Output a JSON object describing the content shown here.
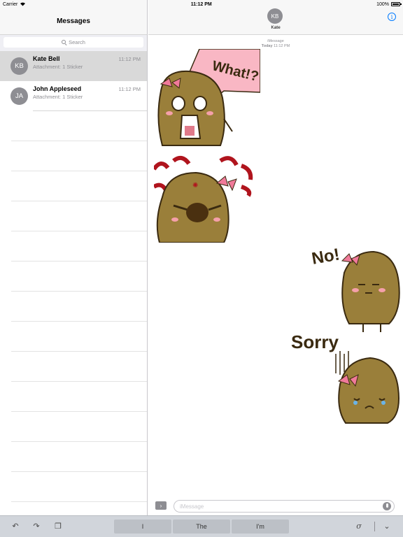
{
  "status_bar": {
    "carrier": "Carrier",
    "time": "11:12 PM",
    "battery": "100%"
  },
  "sidebar": {
    "title": "Messages",
    "search_placeholder": "Search",
    "conversations": [
      {
        "initials": "KB",
        "name": "Kate Bell",
        "time": "11:12 PM",
        "preview": "Attachment: 1 Sticker",
        "selected": true
      },
      {
        "initials": "JA",
        "name": "John Appleseed",
        "time": "11:12 PM",
        "preview": "Attachment: 1 Sticker",
        "selected": false
      }
    ]
  },
  "chat": {
    "contact_initials": "KB",
    "contact_name": "Kate",
    "service": "iMessage",
    "timestamp_day": "Today",
    "timestamp_time": "11:12 PM",
    "stickers": [
      {
        "caption": "What!?",
        "side": "left",
        "expression": "shocked"
      },
      {
        "caption": "",
        "side": "left",
        "expression": "angry"
      },
      {
        "caption": "No!",
        "side": "right",
        "expression": "refuse"
      },
      {
        "caption": "Sorry",
        "side": "right",
        "expression": "sad"
      }
    ],
    "input_placeholder": "iMessage"
  },
  "keyboard_bar": {
    "suggestions": [
      "I",
      "The",
      "I'm"
    ]
  },
  "colors": {
    "accent": "#007aff",
    "potato": "#9a7f3a",
    "potato_dark": "#3a2a10",
    "bow": "#f07a9a",
    "speech_pink": "#f9b7c4",
    "anger_red": "#b0141d"
  }
}
